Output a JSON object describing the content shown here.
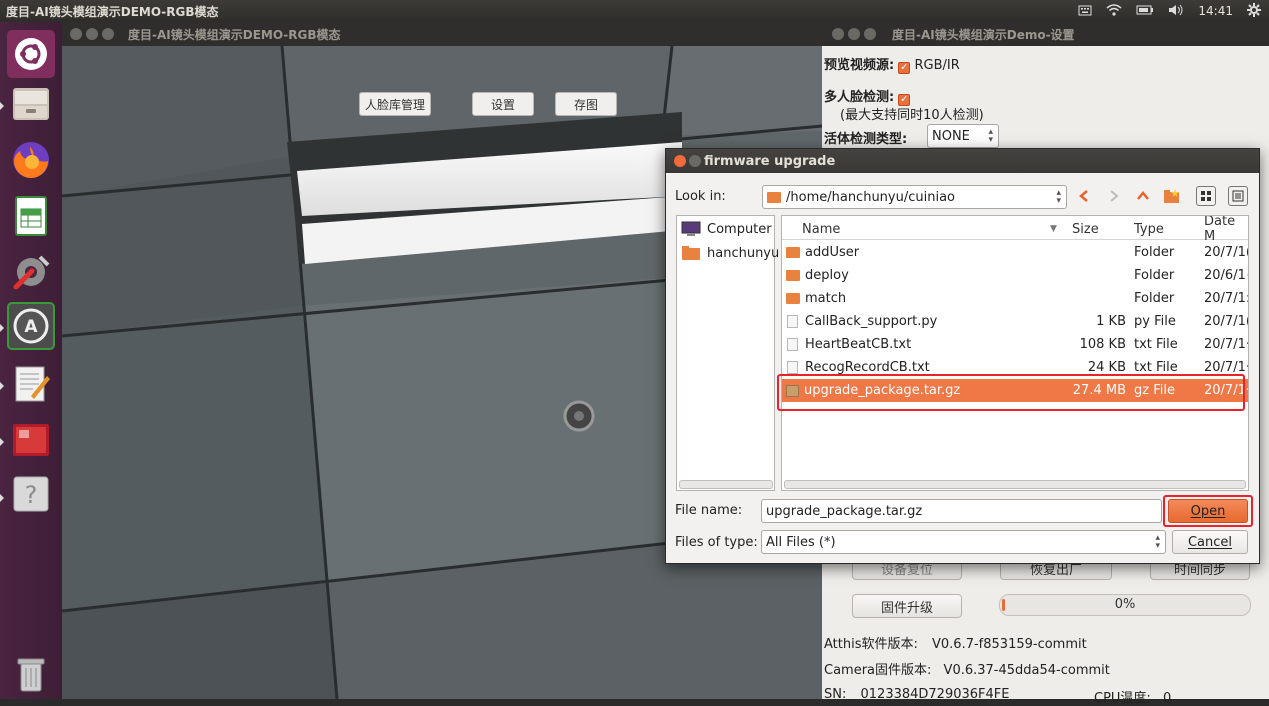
{
  "topbar": {
    "title": "度目-AI镜头模组演示DEMO-RGB模态",
    "time": "14:41"
  },
  "camera_window": {
    "title": "度目-AI镜头模组演示DEMO-RGB模态",
    "buttons": [
      "人脸库管理",
      "设置",
      "存图"
    ]
  },
  "settings_window": {
    "title": "度目-AI镜头模组演示Demo-设置",
    "preview_label": "预览视频源:",
    "preview_value": "RGB/IR",
    "multi_face_label": "多人脸检测:",
    "multi_face_note": "(最大支持同时10人检测)",
    "liveness_label": "活体检测类型:",
    "liveness_value": "NONE",
    "device_reset": "设备复位",
    "factory_reset": "恢复出厂",
    "time_sync": "时间同步",
    "firmware_upgrade": "固件升级",
    "progress_text": "0%",
    "progress_value": 0.01,
    "software_version_label": "Atthis软件版本:",
    "software_version": "V0.6.7-f853159-commit",
    "camera_fw_label": "Camera固件版本:",
    "camera_fw": "V0.6.37-45dda54-commit",
    "sn_label": "SN:",
    "sn": "0123384D729036F4FE",
    "cpu_temp_label": "CPU温度:",
    "cpu_temp": "0"
  },
  "dialog": {
    "title": "firmware upgrade",
    "look_in_label": "Look in:",
    "look_in_path": "/home/hanchunyu/cuiniao",
    "sidebar": [
      "Computer",
      "hanchunyu"
    ],
    "columns": [
      "Name",
      "Size",
      "Type",
      "Date M"
    ],
    "files": [
      {
        "name": "addUser",
        "size": "",
        "type": "Folder",
        "date": "20/7/1(",
        "kind": "folder"
      },
      {
        "name": "deploy",
        "size": "",
        "type": "Folder",
        "date": "20/6/1{",
        "kind": "folder"
      },
      {
        "name": "match",
        "size": "",
        "type": "Folder",
        "date": "20/7/1:",
        "kind": "folder"
      },
      {
        "name": "CallBack_support.py",
        "size": "1 KB",
        "type": "py File",
        "date": "20/7/1(",
        "kind": "file"
      },
      {
        "name": "HeartBeatCB.txt",
        "size": "108 KB",
        "type": "txt File",
        "date": "20/7/1·",
        "kind": "file"
      },
      {
        "name": "RecogRecordCB.txt",
        "size": "24 KB",
        "type": "txt File",
        "date": "20/7/1·",
        "kind": "file"
      },
      {
        "name": "upgrade_package.tar.gz",
        "size": "27.4 MB",
        "type": "gz File",
        "date": "20/7/1·",
        "kind": "archive",
        "selected": true
      }
    ],
    "file_name_label": "File name:",
    "file_name_value": "upgrade_package.tar.gz",
    "file_type_label": "Files of type:",
    "file_type_value": "All Files (*)",
    "open_label": "Open",
    "cancel_label": "Cancel"
  }
}
